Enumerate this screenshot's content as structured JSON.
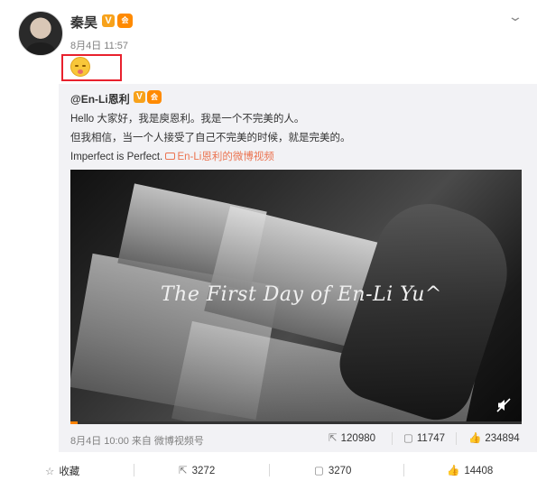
{
  "post": {
    "author": "秦昊",
    "time": "8月4日 11:57",
    "badge_v": "V",
    "badge_crown": "会"
  },
  "repost": {
    "author": "@En-Li恩利",
    "badge_v": "V",
    "badge_crown": "会",
    "line1": "Hello 大家好，我是庾恩利。我是一个不完美的人。",
    "line2": "但我相信，当一个人接受了自己不完美的时候，就是完美的。",
    "line3_text": "Imperfect is Perfect.",
    "video_link": "En-Li恩利的微博视频",
    "video_title": "The First Day of En-Li Yu^",
    "video_progress_percent": 1.6,
    "meta": "8月4日 10:00 来自 微博视频号",
    "shares": "120980",
    "comments": "11747",
    "likes": "234894"
  },
  "actions": {
    "favorite": "收藏",
    "share": "3272",
    "comment": "3270",
    "like": "14408"
  },
  "colors": {
    "accent": "#eb7350",
    "highlight_box": "#e8212d",
    "progress": "#ff8200"
  }
}
